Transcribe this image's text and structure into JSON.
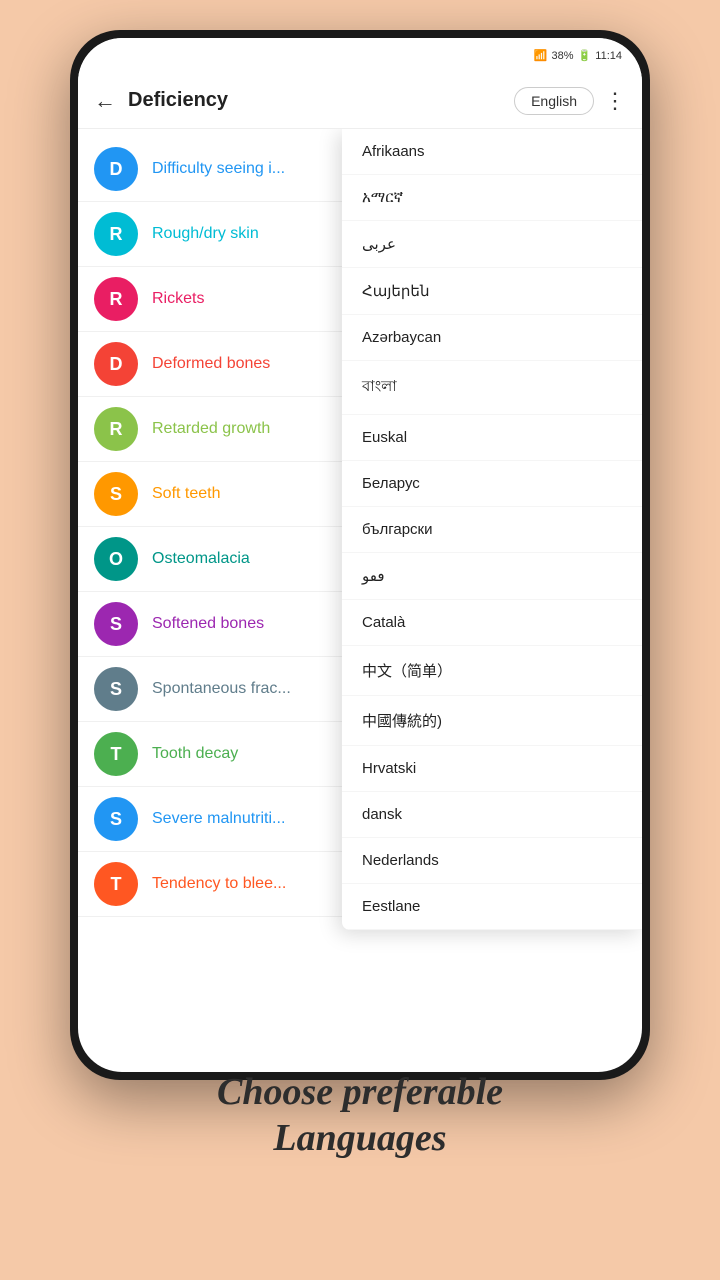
{
  "status_bar": {
    "wifi_icon": "wifi",
    "battery_icon": "battery",
    "battery_percent": "38%",
    "time": "11:14"
  },
  "header": {
    "back_icon": "←",
    "title": "Deficiency",
    "language_button": "English",
    "more_icon": "⋮"
  },
  "symptoms": [
    {
      "id": 1,
      "letter": "D",
      "color": "#2196F3",
      "text": "Difficulty seeing i..."
    },
    {
      "id": 2,
      "letter": "R",
      "color": "#00BCD4",
      "text": "Rough/dry skin"
    },
    {
      "id": 3,
      "letter": "R",
      "color": "#E91E63",
      "text": "Rickets"
    },
    {
      "id": 4,
      "letter": "D",
      "color": "#F44336",
      "text": "Deformed bones"
    },
    {
      "id": 5,
      "letter": "R",
      "color": "#8BC34A",
      "text": "Retarded growth"
    },
    {
      "id": 6,
      "letter": "S",
      "color": "#FF9800",
      "text": "Soft teeth"
    },
    {
      "id": 7,
      "letter": "O",
      "color": "#009688",
      "text": "Osteomalacia"
    },
    {
      "id": 8,
      "letter": "S",
      "color": "#9C27B0",
      "text": "Softened bones"
    },
    {
      "id": 9,
      "letter": "S",
      "color": "#607D8B",
      "text": "Spontaneous frac..."
    },
    {
      "id": 10,
      "letter": "T",
      "color": "#4CAF50",
      "text": "Tooth decay"
    },
    {
      "id": 11,
      "letter": "S",
      "color": "#2196F3",
      "text": "Severe malnutriti..."
    },
    {
      "id": 12,
      "letter": "T",
      "color": "#FF5722",
      "text": "Tendency to blee..."
    }
  ],
  "languages": [
    "Afrikaans",
    "አማርኛ",
    "عربى",
    "Հայերեն",
    "Azərbaycan",
    "বাংলা",
    "Euskal",
    "Беларус",
    "български",
    "ٯٯو",
    "Català",
    "中文（简单）",
    "中國傳統的)",
    "Hrvatski",
    "dansk",
    "Nederlands",
    "Eestlane"
  ],
  "caption": {
    "line1": "Choose preferable",
    "line2": "Languages"
  }
}
